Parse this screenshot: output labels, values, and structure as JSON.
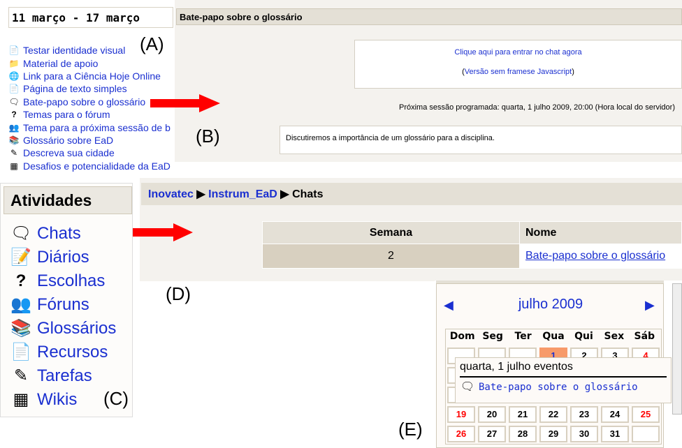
{
  "panel_a": {
    "week_header": "11 março - 17 março",
    "items": [
      {
        "icon": "page-icon",
        "label": "Testar identidade visual"
      },
      {
        "icon": "folder-icon",
        "label": "Material de apoio"
      },
      {
        "icon": "globe-link-icon",
        "label": "Link para a Ciência Hoje Online"
      },
      {
        "icon": "page-icon",
        "label": "Página de texto simples"
      },
      {
        "icon": "chat-icon",
        "label": "Bate-papo sobre o glossário"
      },
      {
        "icon": "question-icon",
        "label": "Temas para o fórum"
      },
      {
        "icon": "forum-icon",
        "label": "Tema para a próxima sessão de b"
      },
      {
        "icon": "glossary-icon",
        "label": "Glossário sobre EaD"
      },
      {
        "icon": "assignment-icon",
        "label": "Descreva sua cidade"
      },
      {
        "icon": "wiki-icon",
        "label": "Desafios e potencialidade da EaD"
      }
    ]
  },
  "panel_b": {
    "title": "Bate-papo sobre o glossário",
    "enter_link": "Clique aqui para entrar no chat agora",
    "noframes_link": "Versão sem framese Javascript",
    "next_session": "Próxima sessão programada: quarta, 1 julho 2009, 20:00 (Hora local do servidor)",
    "description": "Discutiremos a importância de um glossário para a disciplina."
  },
  "panel_c": {
    "title": "Atividades",
    "items": [
      {
        "icon": "chat-icon",
        "label": "Chats"
      },
      {
        "icon": "journal-icon",
        "label": "Diários"
      },
      {
        "icon": "question-icon",
        "label": "Escolhas"
      },
      {
        "icon": "forum-icon",
        "label": "Fóruns"
      },
      {
        "icon": "glossary-icon",
        "label": "Glossários"
      },
      {
        "icon": "page-icon",
        "label": "Recursos"
      },
      {
        "icon": "assignment-icon",
        "label": "Tarefas"
      },
      {
        "icon": "wiki-icon",
        "label": "Wikis"
      }
    ]
  },
  "panel_d": {
    "breadcrumb": [
      "Inovatec",
      "Instrum_EaD",
      "Chats"
    ],
    "columns": [
      "Semana",
      "Nome"
    ],
    "rows": [
      {
        "week": "2",
        "name": "Bate-papo sobre o glossário"
      }
    ]
  },
  "panel_e": {
    "month": "julho 2009",
    "weekdays": [
      "Dom",
      "Seg",
      "Ter",
      "Qua",
      "Qui",
      "Sex",
      "Sáb"
    ],
    "weeks": [
      [
        "",
        "",
        "",
        "1",
        "2",
        "3",
        "4"
      ],
      [
        "",
        "",
        "",
        "",
        "",
        "",
        ""
      ],
      [
        "",
        "",
        "",
        "",
        "",
        "",
        ""
      ],
      [
        "19",
        "20",
        "21",
        "22",
        "23",
        "24",
        "25"
      ],
      [
        "26",
        "27",
        "28",
        "29",
        "30",
        "31",
        ""
      ]
    ],
    "today": "1",
    "weekend_color": "#ff0000",
    "event_color": "#f79a6a",
    "tooltip": {
      "title": "quarta, 1 julho eventos",
      "event": "Bate-papo sobre o glossário"
    }
  },
  "labels": {
    "a": "(A)",
    "b": "(B)",
    "c": "(C)",
    "d": "(D)",
    "e": "(E)"
  },
  "colors": {
    "link": "#1a2fd0",
    "arrow": "#ff0000",
    "header_bg": "#e4e0d6"
  }
}
